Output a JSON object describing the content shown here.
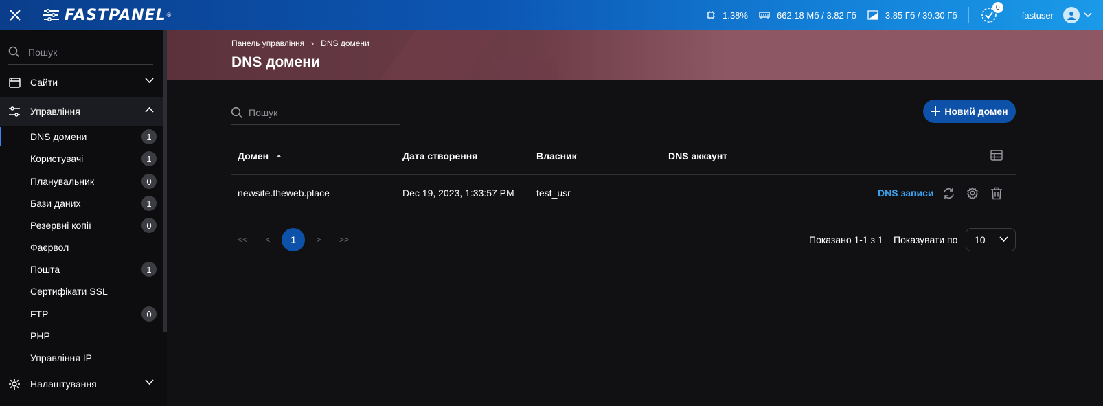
{
  "app": {
    "logo_text": "FASTPANEL",
    "logo_reg": "®"
  },
  "topbar": {
    "cpu": "1.38%",
    "ram": "662.18 Мб / 3.82 Гб",
    "disk": "3.85 Гб / 39.30 Гб",
    "notifications": "0",
    "username": "fastuser"
  },
  "sidebar": {
    "search_placeholder": "Пошук",
    "sites_label": "Сайти",
    "management_label": "Управління",
    "items": [
      {
        "label": "DNS домени",
        "badge": "1"
      },
      {
        "label": "Користувачі",
        "badge": "1"
      },
      {
        "label": "Планувальник",
        "badge": "0"
      },
      {
        "label": "Бази даних",
        "badge": "1"
      },
      {
        "label": "Резервні копії",
        "badge": "0"
      },
      {
        "label": "Фаєрвол",
        "badge": ""
      },
      {
        "label": "Пошта",
        "badge": "1"
      },
      {
        "label": "Сертифікати SSL",
        "badge": ""
      },
      {
        "label": "FTP",
        "badge": "0"
      },
      {
        "label": "PHP",
        "badge": ""
      },
      {
        "label": "Управління IP",
        "badge": ""
      }
    ],
    "settings_label": "Налаштування"
  },
  "header": {
    "breadcrumb_root": "Панель управління",
    "breadcrumb_current": "DNS домени",
    "title": "DNS домени"
  },
  "toolbar": {
    "search_placeholder": "Пошук",
    "new_domain_label": "Новий домен"
  },
  "table": {
    "columns": [
      "Домен",
      "Дата створення",
      "Власник",
      "DNS аккаунт"
    ],
    "rows": [
      {
        "domain": "newsite.theweb.place",
        "created": "Dec 19, 2023, 1:33:57 PM",
        "owner": "test_usr",
        "dns_account": "",
        "dns_link": "DNS записи"
      }
    ]
  },
  "pagination": {
    "first": "<<",
    "prev": "<",
    "current": "1",
    "next": ">",
    "last": ">>",
    "shown": "Показано 1-1 з 1",
    "per_page_label": "Показувати по",
    "per_page_value": "10"
  },
  "colors": {
    "accent": "#0d52a8",
    "link": "#3ba3f0",
    "hero": "#8d5863"
  }
}
